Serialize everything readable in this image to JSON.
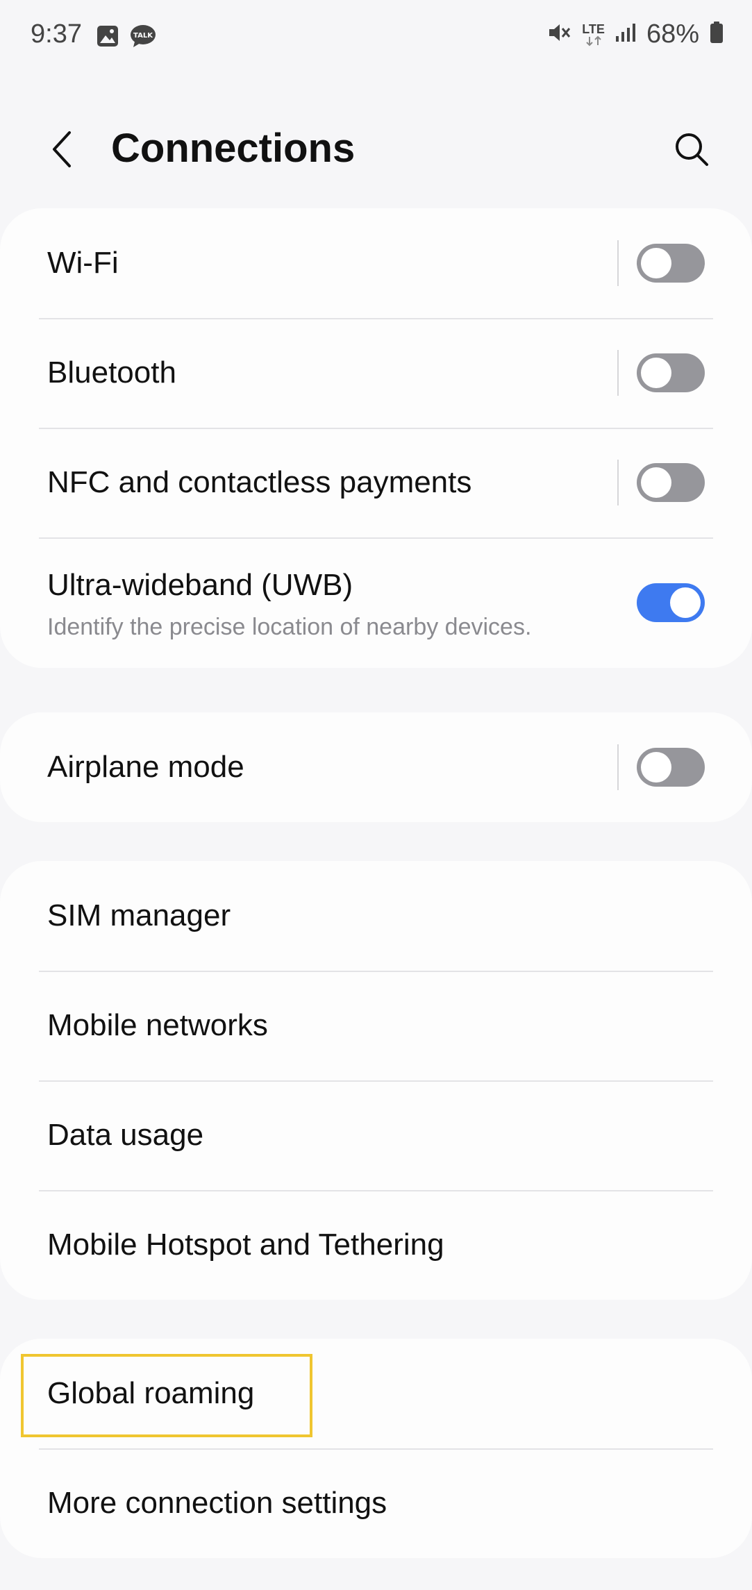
{
  "status_bar": {
    "time": "9:37",
    "left_icons": [
      "gallery-icon",
      "talk-icon"
    ],
    "talk_badge": "TALK",
    "network_type": "LTE",
    "battery": "68%"
  },
  "header": {
    "title": "Connections"
  },
  "groups": [
    {
      "items": [
        {
          "label": "Wi-Fi",
          "toggle": false
        },
        {
          "label": "Bluetooth",
          "toggle": false
        },
        {
          "label": "NFC and contactless payments",
          "toggle": false
        },
        {
          "label": "Ultra-wideband (UWB)",
          "subtitle": "Identify the precise location of nearby devices.",
          "toggle": true
        }
      ]
    },
    {
      "items": [
        {
          "label": "Airplane mode",
          "toggle": false
        }
      ]
    },
    {
      "items": [
        {
          "label": "SIM manager"
        },
        {
          "label": "Mobile networks"
        },
        {
          "label": "Data usage"
        },
        {
          "label": "Mobile Hotspot and Tethering"
        }
      ]
    },
    {
      "items": [
        {
          "label": "Global roaming",
          "highlighted": true
        },
        {
          "label": "More connection settings"
        }
      ]
    }
  ],
  "colors": {
    "toggle_on": "#3e7af0",
    "toggle_off": "#96969b",
    "highlight": "#f0c630",
    "background": "#f6f6f8"
  }
}
